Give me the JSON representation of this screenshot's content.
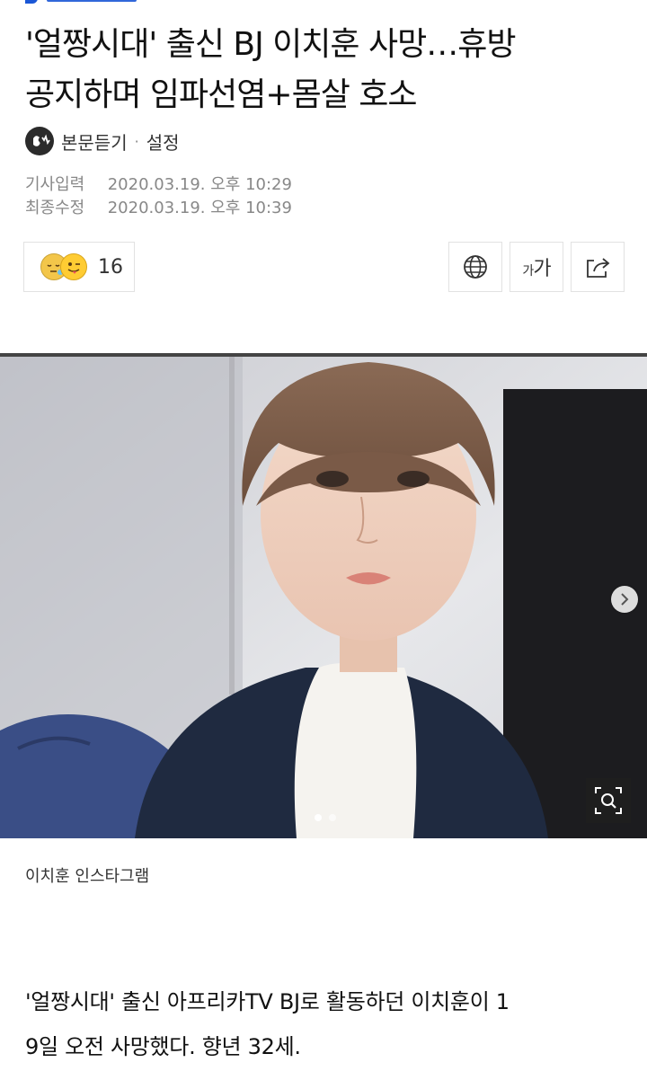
{
  "article": {
    "headline_line1": "'얼짱시대' 출신 BJ 이치훈 사망…휴방",
    "headline_line2": "공지하며 임파선염+몸살 호소",
    "listen_label": "본문듣기",
    "settings_label": "설정",
    "meta": {
      "published_label": "기사입력",
      "published_value": "2020.03.19. 오후 10:29",
      "modified_label": "최종수정",
      "modified_value": "2020.03.19. 오후 10:39"
    },
    "reactions": {
      "count": "16",
      "icons": [
        "sleepy-face-icon",
        "tongue-face-icon"
      ]
    },
    "toolbar": {
      "translate_icon": "globe-icon",
      "font_size_label_small": "가",
      "font_size_label_large": "가",
      "share_icon": "share-icon"
    },
    "photo": {
      "caption": "이치훈 인스타그램",
      "next_icon": "chevron-right-icon",
      "zoom_icon": "zoom-icon",
      "slide_count": 2,
      "active_slide": 1
    },
    "body_line1": "'얼짱시대' 출신 아프리카TV BJ로 활동하던 이치훈이 1",
    "body_line2": "9일 오전 사망했다. 향년 32세."
  },
  "colors": {
    "brand_blue": "#1b57d6",
    "meta_gray": "#888888",
    "border_gray": "#e2e2e2"
  }
}
